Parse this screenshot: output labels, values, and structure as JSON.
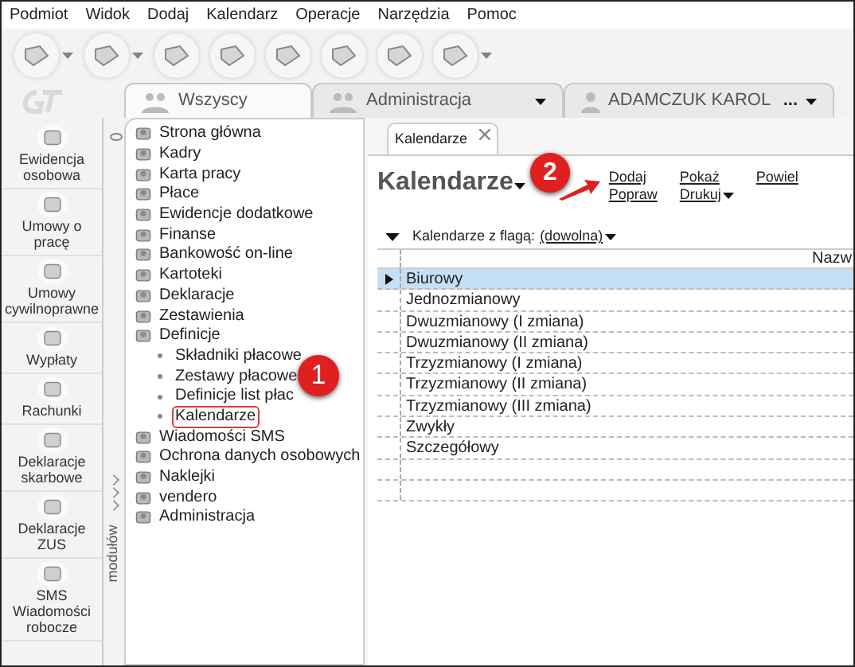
{
  "menu": [
    "Podmiot",
    "Widok",
    "Dodaj",
    "Kalendarz",
    "Operacje",
    "Narzędzia",
    "Pomoc"
  ],
  "group_tabs": [
    {
      "label": "Wszyscy",
      "kind": "group",
      "selected": true,
      "dropdown": false
    },
    {
      "label": "Administracja",
      "kind": "group",
      "selected": false,
      "dropdown": true
    },
    {
      "label": "ADAMCZUK KAROL",
      "kind": "person",
      "selected": false,
      "dropdown": true,
      "more": "..."
    }
  ],
  "modules": {
    "items": [
      "Ewidencja osobowa",
      "Umowy o pracę",
      "Umowy cywilnoprawne",
      "Wypłaty",
      "Rachunki",
      "Deklaracje skarbowe",
      "Deklaracje ZUS",
      "SMS Wiadomości robocze"
    ],
    "strip_label": "modułów"
  },
  "tree": [
    {
      "label": "Strona główna"
    },
    {
      "label": "Kadry"
    },
    {
      "label": "Karta pracy"
    },
    {
      "label": "Płace"
    },
    {
      "label": "Ewidencje dodatkowe"
    },
    {
      "label": "Finanse"
    },
    {
      "label": "Bankowość on-line"
    },
    {
      "label": "Kartoteki"
    },
    {
      "label": "Deklaracje"
    },
    {
      "label": "Zestawienia"
    },
    {
      "label": "Definicje",
      "children": [
        {
          "label": "Składniki płacowe",
          "highlighted": false
        },
        {
          "label": "Zestawy płacowe",
          "highlighted": false
        },
        {
          "label": "Definicje list płac",
          "highlighted": false
        },
        {
          "label": "Kalendarze",
          "highlighted": true
        }
      ]
    },
    {
      "label": "Wiadomości SMS"
    },
    {
      "label": "Ochrona danych osobowych"
    },
    {
      "label": "Naklejki"
    },
    {
      "label": "vendero"
    },
    {
      "label": "Administracja"
    }
  ],
  "document_tab": {
    "label": "Kalendarze"
  },
  "heading": "Kalendarze",
  "actions": [
    {
      "label": "Dodaj",
      "dropdown": false
    },
    {
      "label": "Pokaż",
      "dropdown": false
    },
    {
      "label": "Powiel",
      "dropdown": false
    },
    {
      "label": "Popraw",
      "dropdown": false
    },
    {
      "label": "Drukuj",
      "dropdown": true
    }
  ],
  "filter": {
    "label": "Kalendarze z flagą:",
    "value": "(dowolna)"
  },
  "table": {
    "columns": [
      "Nazw"
    ],
    "rows": [
      {
        "name": "Biurowy",
        "selected": true
      },
      {
        "name": "Jednozmianowy",
        "selected": false
      },
      {
        "name": "Dwuzmianowy (I zmiana)",
        "selected": false
      },
      {
        "name": "Dwuzmianowy (II zmiana)",
        "selected": false
      },
      {
        "name": "Trzyzmianowy (I zmiana)",
        "selected": false
      },
      {
        "name": "Trzyzmianowy (II zmiana)",
        "selected": false
      },
      {
        "name": "Trzyzmianowy (III zmiana)",
        "selected": false
      },
      {
        "name": "Zwykły",
        "selected": false
      },
      {
        "name": "Szczegółowy",
        "selected": false
      }
    ]
  },
  "callouts": [
    "1",
    "2"
  ]
}
